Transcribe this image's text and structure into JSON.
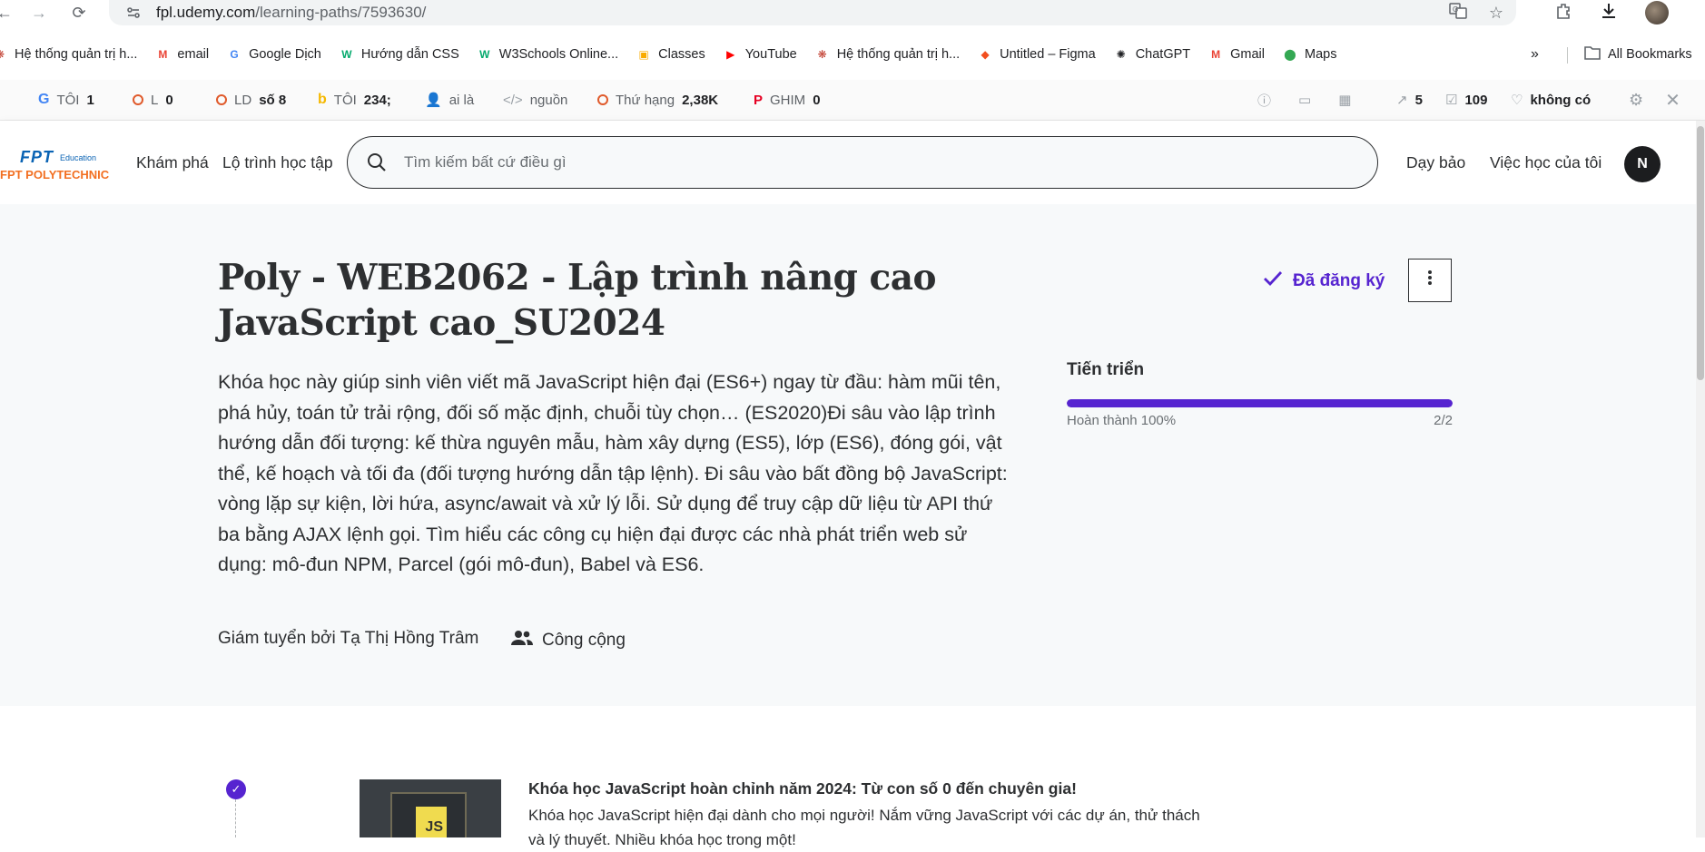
{
  "browser": {
    "url_host": "fpl.udemy.com",
    "url_path": "/learning-paths/7593630/"
  },
  "bookmarks": {
    "items": [
      {
        "label": "Hệ thống quản trị h...",
        "icon": "admin-icon",
        "color": "#c0392b"
      },
      {
        "label": "email",
        "icon": "gmail-icon",
        "color": "#ea4335"
      },
      {
        "label": "Google Dịch",
        "icon": "google-translate-icon",
        "color": "#4285f4"
      },
      {
        "label": "Hướng dẫn CSS",
        "icon": "w3schools-icon",
        "color": "#04aa6d"
      },
      {
        "label": "W3Schools Online...",
        "icon": "w3schools-icon",
        "color": "#04aa6d"
      },
      {
        "label": "Classes",
        "icon": "classroom-icon",
        "color": "#f9ab00"
      },
      {
        "label": "YouTube",
        "icon": "youtube-icon",
        "color": "#ff0000"
      },
      {
        "label": "Hệ thống quản trị h...",
        "icon": "admin-icon",
        "color": "#c0392b"
      },
      {
        "label": "Untitled – Figma",
        "icon": "figma-icon",
        "color": "#f24e1e"
      },
      {
        "label": "ChatGPT",
        "icon": "chatgpt-icon",
        "color": "#202124"
      },
      {
        "label": "Gmail",
        "icon": "gmail-icon",
        "color": "#ea4335"
      },
      {
        "label": "Maps",
        "icon": "maps-icon",
        "color": "#34a853"
      }
    ],
    "more": "»",
    "all_label": "All Bookmarks"
  },
  "seo": {
    "toi_label": "TÔI",
    "toi_value": "1",
    "l_label": "L",
    "l_value": "0",
    "ld_label": "LD",
    "ld_value": "số 8",
    "toi2_label": "TÔI",
    "toi2_value": "234;",
    "ai_la": "ai là",
    "nguon": "nguồn",
    "rank_label": "Thứ hạng",
    "rank_value": "2,38K",
    "pin_label": "GHIM",
    "pin_value": "0",
    "links_value": "5",
    "checked_value": "109",
    "none_label": "không có"
  },
  "header": {
    "logo_top": "FPT",
    "logo_edu": "Education",
    "logo_bottom": "FPT POLYTECHNIC",
    "explore": "Khám phá",
    "learning_paths": "Lộ trình học tập",
    "search_placeholder": "Tìm kiếm bất cứ điều gì",
    "teach": "Dạy bảo",
    "my_learning": "Việc học của tôi",
    "avatar_initial": "N"
  },
  "hero": {
    "title": "Poly - WEB2062 - Lập trình nâng cao JavaScript cao_SU2024",
    "description": "Khóa học này giúp sinh viên viết mã JavaScript hiện đại (ES6+) ngay từ đầu: hàm mũi tên, phá hủy, toán tử trải rộng, đối số mặc định, chuỗi tùy chọn… (ES2020)Đi sâu vào lập trình hướng dẫn đối tượng: kế thừa nguyên mẫu, hàm xây dựng (ES5), lớp (ES6), đóng gói, vật thể, kế hoạch và tối đa (đối tượng hướng dẫn tập lệnh). Đi sâu vào bất đồng bộ JavaScript: vòng lặp sự kiện, lời hứa, async/await và xử lý lỗi. Sử dụng để truy cập dữ liệu từ API thứ ba bằng AJAX lệnh gọi. Tìm hiểu các công cụ hiện đại được các nhà phát triển web sử dụng: mô-đun NPM, Parcel (gói mô-đun), Babel và ES6.",
    "curator": "Giám tuyển bởi Tạ Thị Hồng Trâm",
    "visibility": "Công cộng",
    "enrolled": "Đã đăng ký",
    "progress_title": "Tiến triển",
    "progress_label": "Hoàn thành 100%",
    "progress_count": "2/2",
    "progress_percent": 100,
    "accent_color": "#5624d0"
  },
  "course": {
    "thumb_label": "JS",
    "title": "Khóa học JavaScript hoàn chỉnh năm 2024: Từ con số 0 đến chuyên gia!",
    "description": "Khóa học JavaScript hiện đại dành cho mọi người! Nắm vững JavaScript với các dự án, thử thách và lý thuyết. Nhiều khóa học trong một!"
  }
}
